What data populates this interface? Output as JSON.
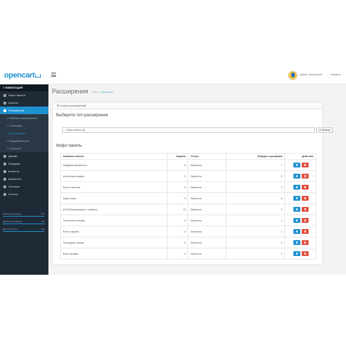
{
  "brand": {
    "logo": "opencart"
  },
  "header": {
    "user": "Admin Opencart",
    "logout": "Выйти"
  },
  "sidebar": {
    "title": "НАВИГАЦИЯ",
    "items": [
      {
        "label": "Инфо панель",
        "icon": "dashboard-icon"
      },
      {
        "label": "Каталог",
        "icon": "tag-icon",
        "arrow": "›"
      },
      {
        "label": "Расширения",
        "icon": "puzzle-icon",
        "arrow": "‹",
        "active": true
      },
      {
        "label": "Дизайн",
        "icon": "monitor-icon",
        "arrow": "›"
      },
      {
        "label": "Продажи",
        "icon": "cart-icon",
        "arrow": "›"
      },
      {
        "label": "Клиенты",
        "icon": "user-icon",
        "arrow": "›"
      },
      {
        "label": "Маркетинг",
        "icon": "share-icon",
        "arrow": "›"
      },
      {
        "label": "Система",
        "icon": "gear-icon",
        "arrow": "›"
      },
      {
        "label": "Отчеты",
        "icon": "chart-icon",
        "arrow": "›"
      }
    ],
    "subitems": [
      {
        "label": "Магазин расширений"
      },
      {
        "label": "Установка"
      },
      {
        "label": "Расширения",
        "current": true
      },
      {
        "label": "Модификаторы"
      },
      {
        "label": "События"
      }
    ],
    "stats": [
      {
        "label": "Заказы выполнены",
        "value": "0%"
      },
      {
        "label": "Заказы в обработке",
        "value": "0%"
      },
      {
        "label": "Другие статусы",
        "value": "0%"
      }
    ]
  },
  "page": {
    "title": "Расширения",
    "breadcrumb": {
      "home": "Главная",
      "sep": "›",
      "current": "Расширения"
    },
    "panel_title": "Список расширений",
    "choose_title": "Выберите тип расширения",
    "select_value": "Инфо панель (9)",
    "filter_label": "Фильтр",
    "section_title": "Инфо панель"
  },
  "table": {
    "headers": {
      "name": "Название панели",
      "width": "Ширина",
      "status": "Статус",
      "sort": "Порядок сортировки",
      "action": "Действие"
    },
    "rows": [
      {
        "name": "Недавняя активность",
        "width": "4",
        "status": "Включено",
        "sort": "7"
      },
      {
        "name": "Аналитика продаж",
        "width": "3",
        "status": "Включено",
        "sort": "6"
      },
      {
        "name": "Всего клиентов",
        "width": "3",
        "status": "Включено",
        "sort": "3"
      },
      {
        "name": "Карта мира",
        "width": "3",
        "status": "Включено",
        "sort": "5"
      },
      {
        "name": "[OCN] Информация и сервисы",
        "width": "12",
        "status": "Включено",
        "sort": "0"
      },
      {
        "name": "Посетители онлайн",
        "width": "3",
        "status": "Включено",
        "sort": "4"
      },
      {
        "name": "Всего заказов",
        "width": "3",
        "status": "Включено",
        "sort": "1"
      },
      {
        "name": "Последние заказы",
        "width": "8",
        "status": "Включено",
        "sort": "8"
      },
      {
        "name": "Всего продаж",
        "width": "3",
        "status": "Включено",
        "sort": "2"
      }
    ]
  },
  "colors": {
    "accent": "#1e91cf",
    "danger": "#e3503e",
    "sidebar": "#1f2a37"
  }
}
